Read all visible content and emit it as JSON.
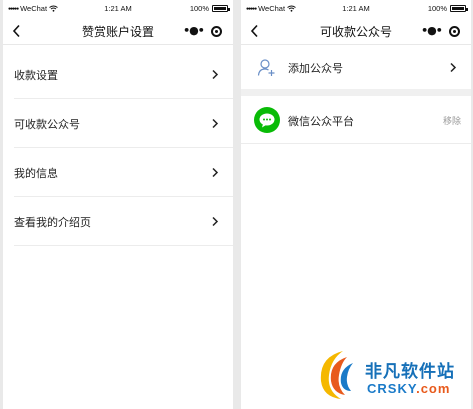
{
  "left_screen": {
    "status": {
      "carrier": "WeChat",
      "time": "1:21 AM",
      "battery": "100%"
    },
    "title": "赞赏账户设置",
    "items": [
      {
        "label": "收款设置"
      },
      {
        "label": "可收款公众号"
      },
      {
        "label": "我的信息"
      },
      {
        "label": "查看我的介绍页"
      }
    ]
  },
  "right_screen": {
    "status": {
      "carrier": "WeChat",
      "time": "1:21 AM",
      "battery": "100%"
    },
    "title": "可收款公众号",
    "add_label": "添加公众号",
    "accounts": [
      {
        "name": "微信公众平台",
        "action": "移除"
      }
    ]
  },
  "watermark": {
    "cn": "非凡软件站",
    "en": "CRSKY",
    "domain": ".com"
  },
  "colors": {
    "wechat_green": "#09bb07",
    "add_icon_blue": "#6a8fc7",
    "remove_gray": "#999999"
  }
}
